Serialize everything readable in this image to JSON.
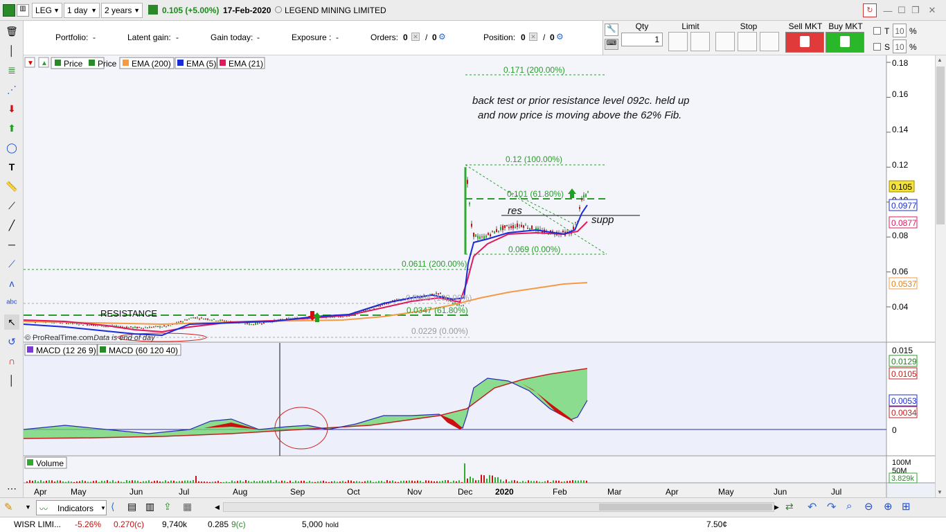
{
  "topbar": {
    "symbol": "LEG",
    "interval": "1 day",
    "period": "2 years",
    "price_change": "0.105 (+5.00%)",
    "date": "17-Feb-2020",
    "company": "LEGEND MINING LIMITED"
  },
  "infobar": {
    "portfolio_label": "Portfolio:",
    "portfolio_value": "-",
    "latent_label": "Latent gain:",
    "latent_value": "-",
    "today_label": "Gain today:",
    "today_value": "-",
    "exposure_label": "Exposure :",
    "exposure_value": "-",
    "orders_label": "Orders:",
    "orders_a": "0",
    "orders_b": "0",
    "position_label": "Position:",
    "position_a": "0",
    "position_b": "0"
  },
  "orderpanel": {
    "qty_label": "Qty",
    "qty_value": "1",
    "limit_label": "Limit",
    "stop_label": "Stop",
    "sell_label": "Sell MKT",
    "buy_label": "Buy MKT",
    "t_label": "T",
    "s_label": "S",
    "t_value": "10",
    "s_value": "10",
    "pct": "%"
  },
  "legend": {
    "price1": "Price",
    "price2": "Price",
    "ema200": "EMA (200)",
    "ema5": "EMA (5)",
    "ema21": "EMA (21)",
    "macd1": "MACD (12 26 9)",
    "macd2": "MACD (60 120 40)",
    "volume": "Volume",
    "copyright": "© ProRealTime.com",
    "eod": "Data is end of day"
  },
  "annotations": {
    "note_line1": "back test or prior resistance level 092c. held up",
    "note_line2": "and now price is moving above the 62% Fib.",
    "res": "res",
    "supp": "supp",
    "resistance": "RESISTANCE"
  },
  "fib_labels": {
    "upper_200": "0.171 (200.00%)",
    "upper_100": "0.12 (100.00%)",
    "upper_618": "0.101 (61.80%)",
    "upper_0": "0.069 (0.00%)",
    "lower_200": "0.0611 (200.00%)",
    "lower_100": "0.0465 (100.00%)",
    "lower_618": "0.0347 (61.80%)",
    "lower_0": "0.0229 (0.00%)"
  },
  "price_axis": {
    "ticks": [
      "0.18",
      "0.16",
      "0.14",
      "0.12",
      "0.10",
      "0.08",
      "0.06",
      "0.04"
    ],
    "tag_last": "0.105",
    "tag_ema5": "0.0977",
    "tag_ema21": "0.0877",
    "tag_ema200": "0.0537"
  },
  "macd_axis": {
    "ticks": [
      "0.015",
      "0"
    ],
    "tag1": "0.0129",
    "tag2": "0.0105",
    "tag3": "0.0053",
    "tag4": "0.0034"
  },
  "volume_axis": {
    "tick1": "100M",
    "tick2": "50M",
    "tag": "3.829k"
  },
  "time_axis": [
    "Apr",
    "May",
    "Jun",
    "Jul",
    "Aug",
    "Sep",
    "Oct",
    "Nov",
    "Dec",
    "2020",
    "Feb",
    "Mar",
    "Apr",
    "May",
    "Jun",
    "Jul"
  ],
  "bottombar": {
    "indicators": "Indicators"
  },
  "bottomlist": {
    "name": "WISR LIMI...",
    "change": "-5.26%",
    "price": "0.270(c)",
    "vol": "9,740k",
    "p2": "0.285",
    "p3": "9(c)",
    "qty": "5,000",
    "txt1": "hold",
    "price_right": "7.50¢"
  },
  "colors": {
    "ema200": "#f59a43",
    "ema5": "#1a2bd8",
    "ema21": "#e0195c",
    "fib": "#2a9a2a",
    "bull": "#2eaa2e",
    "bear": "#cc1010"
  }
}
